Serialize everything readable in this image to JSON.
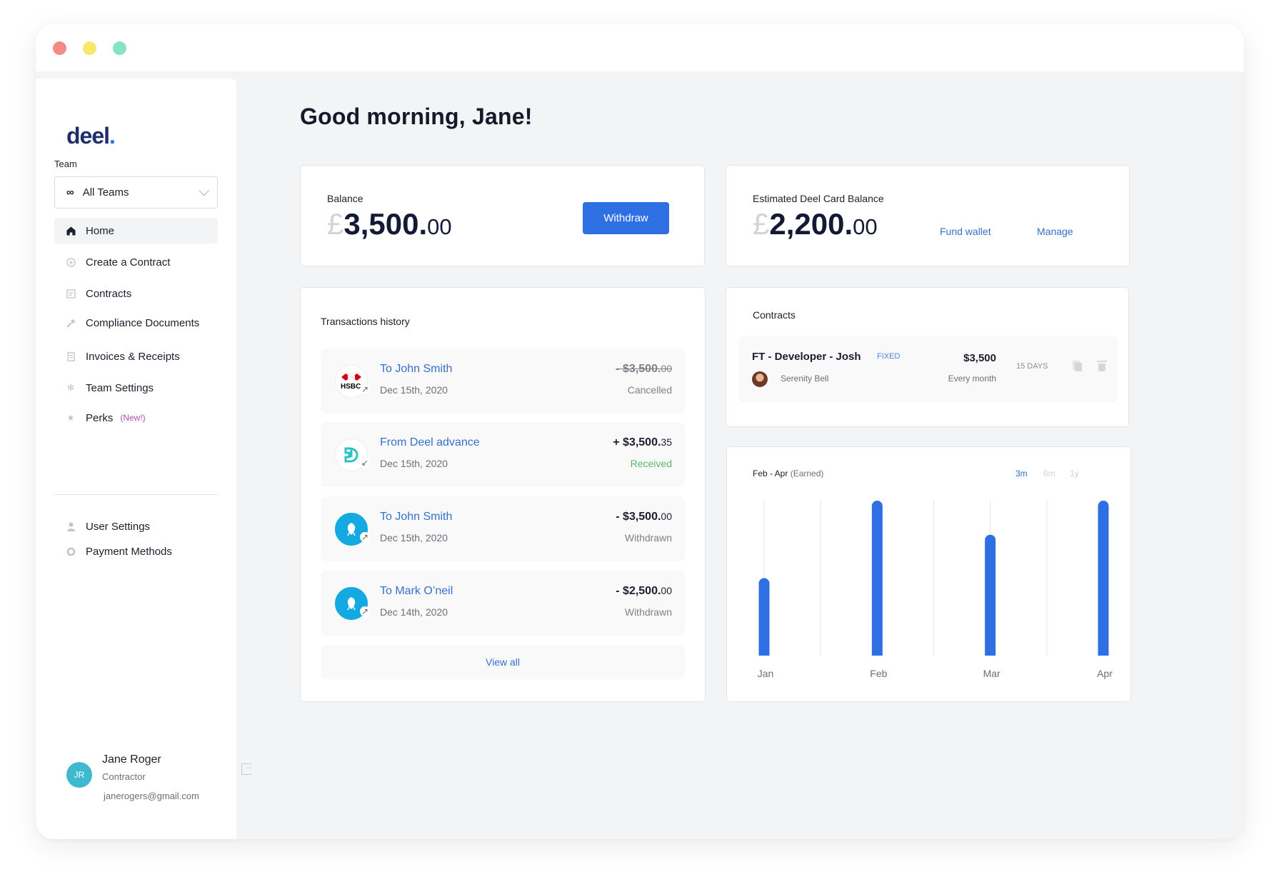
{
  "window": {
    "controls": [
      "close",
      "minimize",
      "maximize"
    ]
  },
  "sidebar": {
    "logo": "deel",
    "team_label": "Team",
    "team_select": {
      "icon": "infinity-icon",
      "value": "All Teams"
    },
    "items": [
      {
        "label": "Home",
        "icon": "home-icon",
        "active": true
      },
      {
        "label": "Create a Contract",
        "icon": "plus-circle-icon"
      },
      {
        "label": "Contracts",
        "icon": "document-icon"
      },
      {
        "label": "Compliance Documents",
        "icon": "hammer-icon"
      },
      {
        "label": "Invoices & Receipts",
        "icon": "receipt-icon"
      },
      {
        "label": "Team Settings",
        "icon": "gear-icon"
      },
      {
        "label": "Perks",
        "icon": "star-icon",
        "badge": "(New!)"
      }
    ],
    "secondary_items": [
      {
        "label": "User Settings",
        "icon": "user-icon"
      },
      {
        "label": "Payment Methods",
        "icon": "shield-icon"
      }
    ],
    "user": {
      "initials": "JR",
      "name": "Jane Roger",
      "role": "Contractor",
      "email": "janerogers@gmail.com"
    }
  },
  "main": {
    "greeting": "Good morning, Jane!",
    "balance": {
      "label": "Balance",
      "currency": "£",
      "whole": "3,500.",
      "decimal": "00",
      "action": "Withdraw"
    },
    "card_balance": {
      "label": "Estimated Deel Card Balance",
      "currency": "£",
      "whole": "2,200.",
      "decimal": "00",
      "fund_wallet": "Fund wallet",
      "manage": "Manage"
    },
    "transactions": {
      "title": "Transactions history",
      "items": [
        {
          "title": "To John Smith",
          "date": "Dec 15th, 2020",
          "amount": "- $3,500.",
          "amount_dec": "00",
          "status": "Cancelled",
          "bank": "HSBC",
          "direction": "outgoing"
        },
        {
          "title": "From Deel advance",
          "date": "Dec 15th, 2020",
          "amount": "+ $3,500.",
          "amount_dec": "35",
          "status": "Received",
          "bank": "Deel",
          "direction": "incoming"
        },
        {
          "title": "To John Smith",
          "date": "Dec 15th, 2020",
          "amount": "- $3,500.",
          "amount_dec": "00",
          "status": "Withdrawn",
          "bank": "Barclays",
          "direction": "outgoing"
        },
        {
          "title": "To Mark O’neil",
          "date": "Dec 14th, 2020",
          "amount": "- $2,500.",
          "amount_dec": "00",
          "status": "Withdrawn",
          "bank": "Barclays",
          "direction": "outgoing"
        }
      ],
      "view_all": "View all"
    },
    "contracts": {
      "title": "Contracts",
      "items": [
        {
          "title": "FT - Developer - Josh",
          "type": "FIXED",
          "person": "Serenity Bell",
          "amount": "$3,500",
          "frequency": "Every month",
          "days": "15 DAYS"
        }
      ]
    },
    "earnings": {
      "title": "Feb - Apr",
      "subtitle": "(Earned)",
      "ranges": [
        {
          "label": "3m",
          "active": true
        },
        {
          "label": "6m",
          "active": false
        },
        {
          "label": "1y",
          "active": false
        }
      ]
    }
  },
  "colors": {
    "accent": "#2f6fe4",
    "link": "#3570c9",
    "received": "#56b86a",
    "brand_navy": "#1e2e6b",
    "perks_badge": "#b54bb7"
  },
  "chart_data": {
    "type": "bar",
    "title": "Feb - Apr (Earned)",
    "categories": [
      "Jan",
      "Feb",
      "Mar",
      "Apr"
    ],
    "values": [
      0.5,
      1.0,
      0.78,
      1.0
    ],
    "xlabel": "",
    "ylabel": "",
    "ylim": [
      0,
      1
    ],
    "grid": true,
    "legend": "none",
    "note": "relative earnings; no y-axis values shown"
  }
}
